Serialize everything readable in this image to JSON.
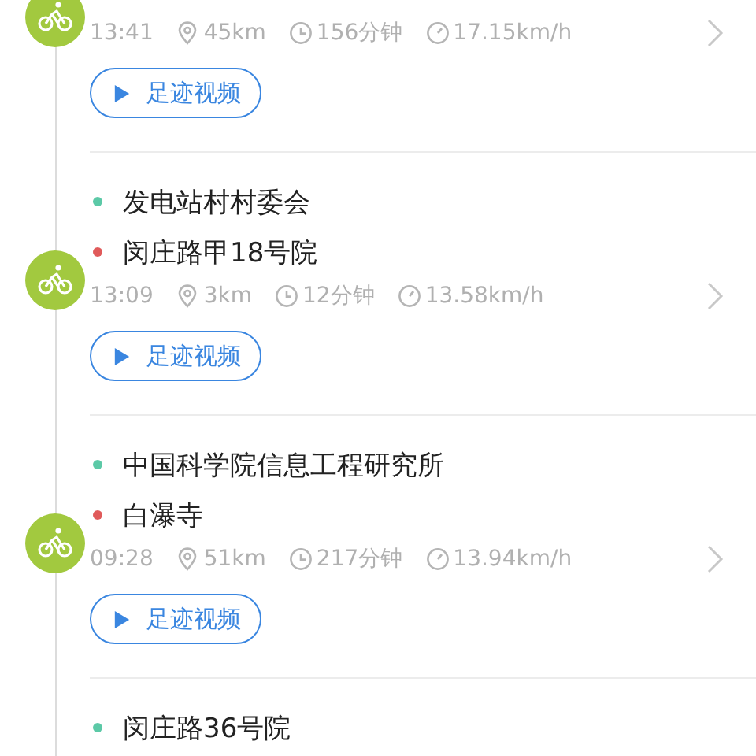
{
  "trips": [
    {
      "time": "13:41",
      "distance": "45km",
      "duration": "156分钟",
      "speed": "17.15km/h",
      "button": "足迹视频"
    },
    {
      "stops": [
        {
          "name": "发电站村村委会",
          "color": "#5cc9a7"
        },
        {
          "name": "闵庄路甲18号院",
          "color": "#e05a5a"
        }
      ],
      "time": "13:09",
      "distance": "3km",
      "duration": "12分钟",
      "speed": "13.58km/h",
      "button": "足迹视频"
    },
    {
      "stops": [
        {
          "name": "中国科学院信息工程研究所",
          "color": "#5cc9a7"
        },
        {
          "name": "白瀑寺",
          "color": "#e05a5a"
        }
      ],
      "time": "09:28",
      "distance": "51km",
      "duration": "217分钟",
      "speed": "13.94km/h",
      "button": "足迹视频"
    },
    {
      "stops": [
        {
          "name": "闵庄路36号院",
          "color": "#5cc9a7"
        }
      ]
    }
  ]
}
